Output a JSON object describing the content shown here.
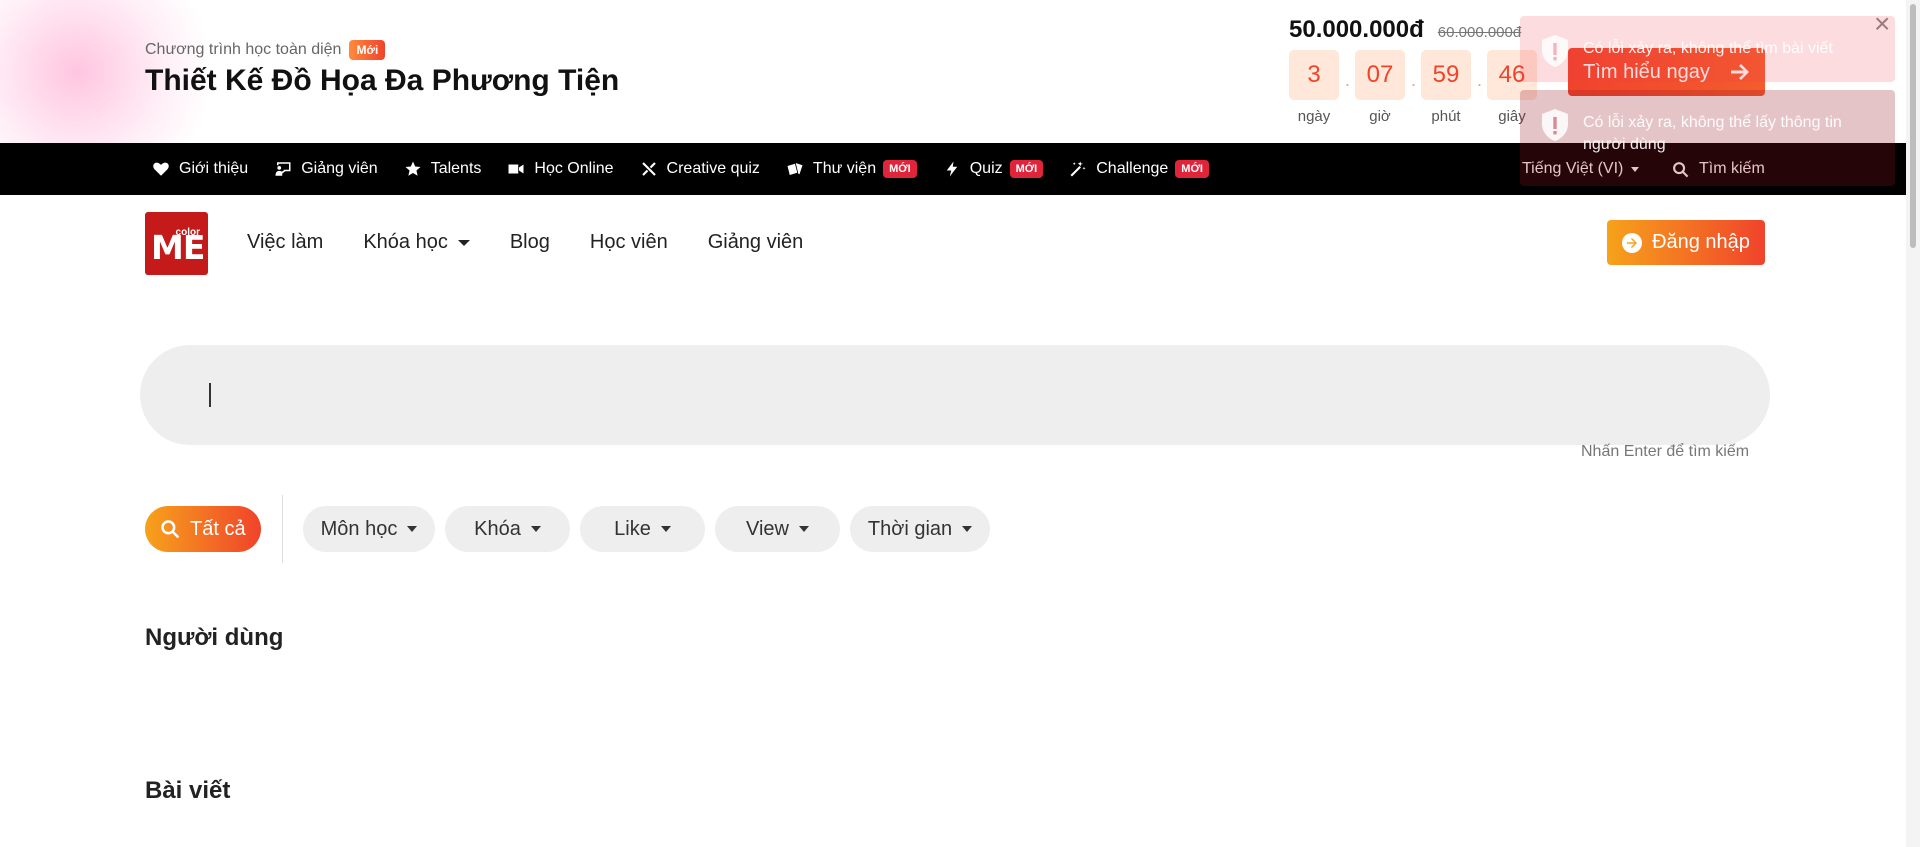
{
  "promo": {
    "subtitle": "Chương trình học toàn diện",
    "badge": "Mới",
    "title": "Thiết Kế Đồ Họa Đa Phương Tiện",
    "price_now": "50.000.000đ",
    "price_old": "60.000.000đ",
    "countdown": [
      {
        "value": "3",
        "label": "ngày"
      },
      {
        "value": "07",
        "label": "giờ"
      },
      {
        "value": "59",
        "label": "phút"
      },
      {
        "value": "46",
        "label": "giây"
      }
    ],
    "cta": "Tìm hiểu ngay",
    "close": "×"
  },
  "topnav": {
    "items": [
      {
        "label": "Giới thiệu",
        "icon": "heart-icon"
      },
      {
        "label": "Giảng viên",
        "icon": "teacher-icon"
      },
      {
        "label": "Talents",
        "icon": "star-icon"
      },
      {
        "label": "Học Online",
        "icon": "video-icon"
      },
      {
        "label": "Creative quiz",
        "icon": "tools-icon"
      },
      {
        "label": "Thư viện",
        "icon": "cards-icon",
        "badge": "MỚI"
      },
      {
        "label": "Quiz",
        "icon": "bolt-icon",
        "badge": "MỚI"
      },
      {
        "label": "Challenge",
        "icon": "magic-wand-icon",
        "badge": "MỚI"
      }
    ],
    "language": "Tiếng Việt (VI)",
    "search": "Tìm kiếm"
  },
  "toasts": [
    {
      "text": "Có lỗi xảy ra, không thể tìm bài viết"
    },
    {
      "text": "Có lỗi xảy ra, không thể lấy thông tin người dùng"
    }
  ],
  "mainnav": {
    "logo_main": "ME",
    "logo_small": "color",
    "menu": [
      "Việc làm",
      "Khóa học",
      "Blog",
      "Học viên",
      "Giảng viên"
    ],
    "login": "Đăng nhập"
  },
  "search": {
    "value": "",
    "hint": "Nhấn Enter để tìm kiếm"
  },
  "filters": {
    "all": "Tất cả",
    "chips": [
      "Môn học",
      "Khóa",
      "Like",
      "View",
      "Thời gian"
    ]
  },
  "sections": {
    "users": "Người dùng",
    "posts": "Bài viết"
  },
  "colors": {
    "accent_orange": "#f7a21b",
    "accent_red": "#f0432b",
    "brand_red": "#c41a1a",
    "badge_red": "#e0243a"
  }
}
